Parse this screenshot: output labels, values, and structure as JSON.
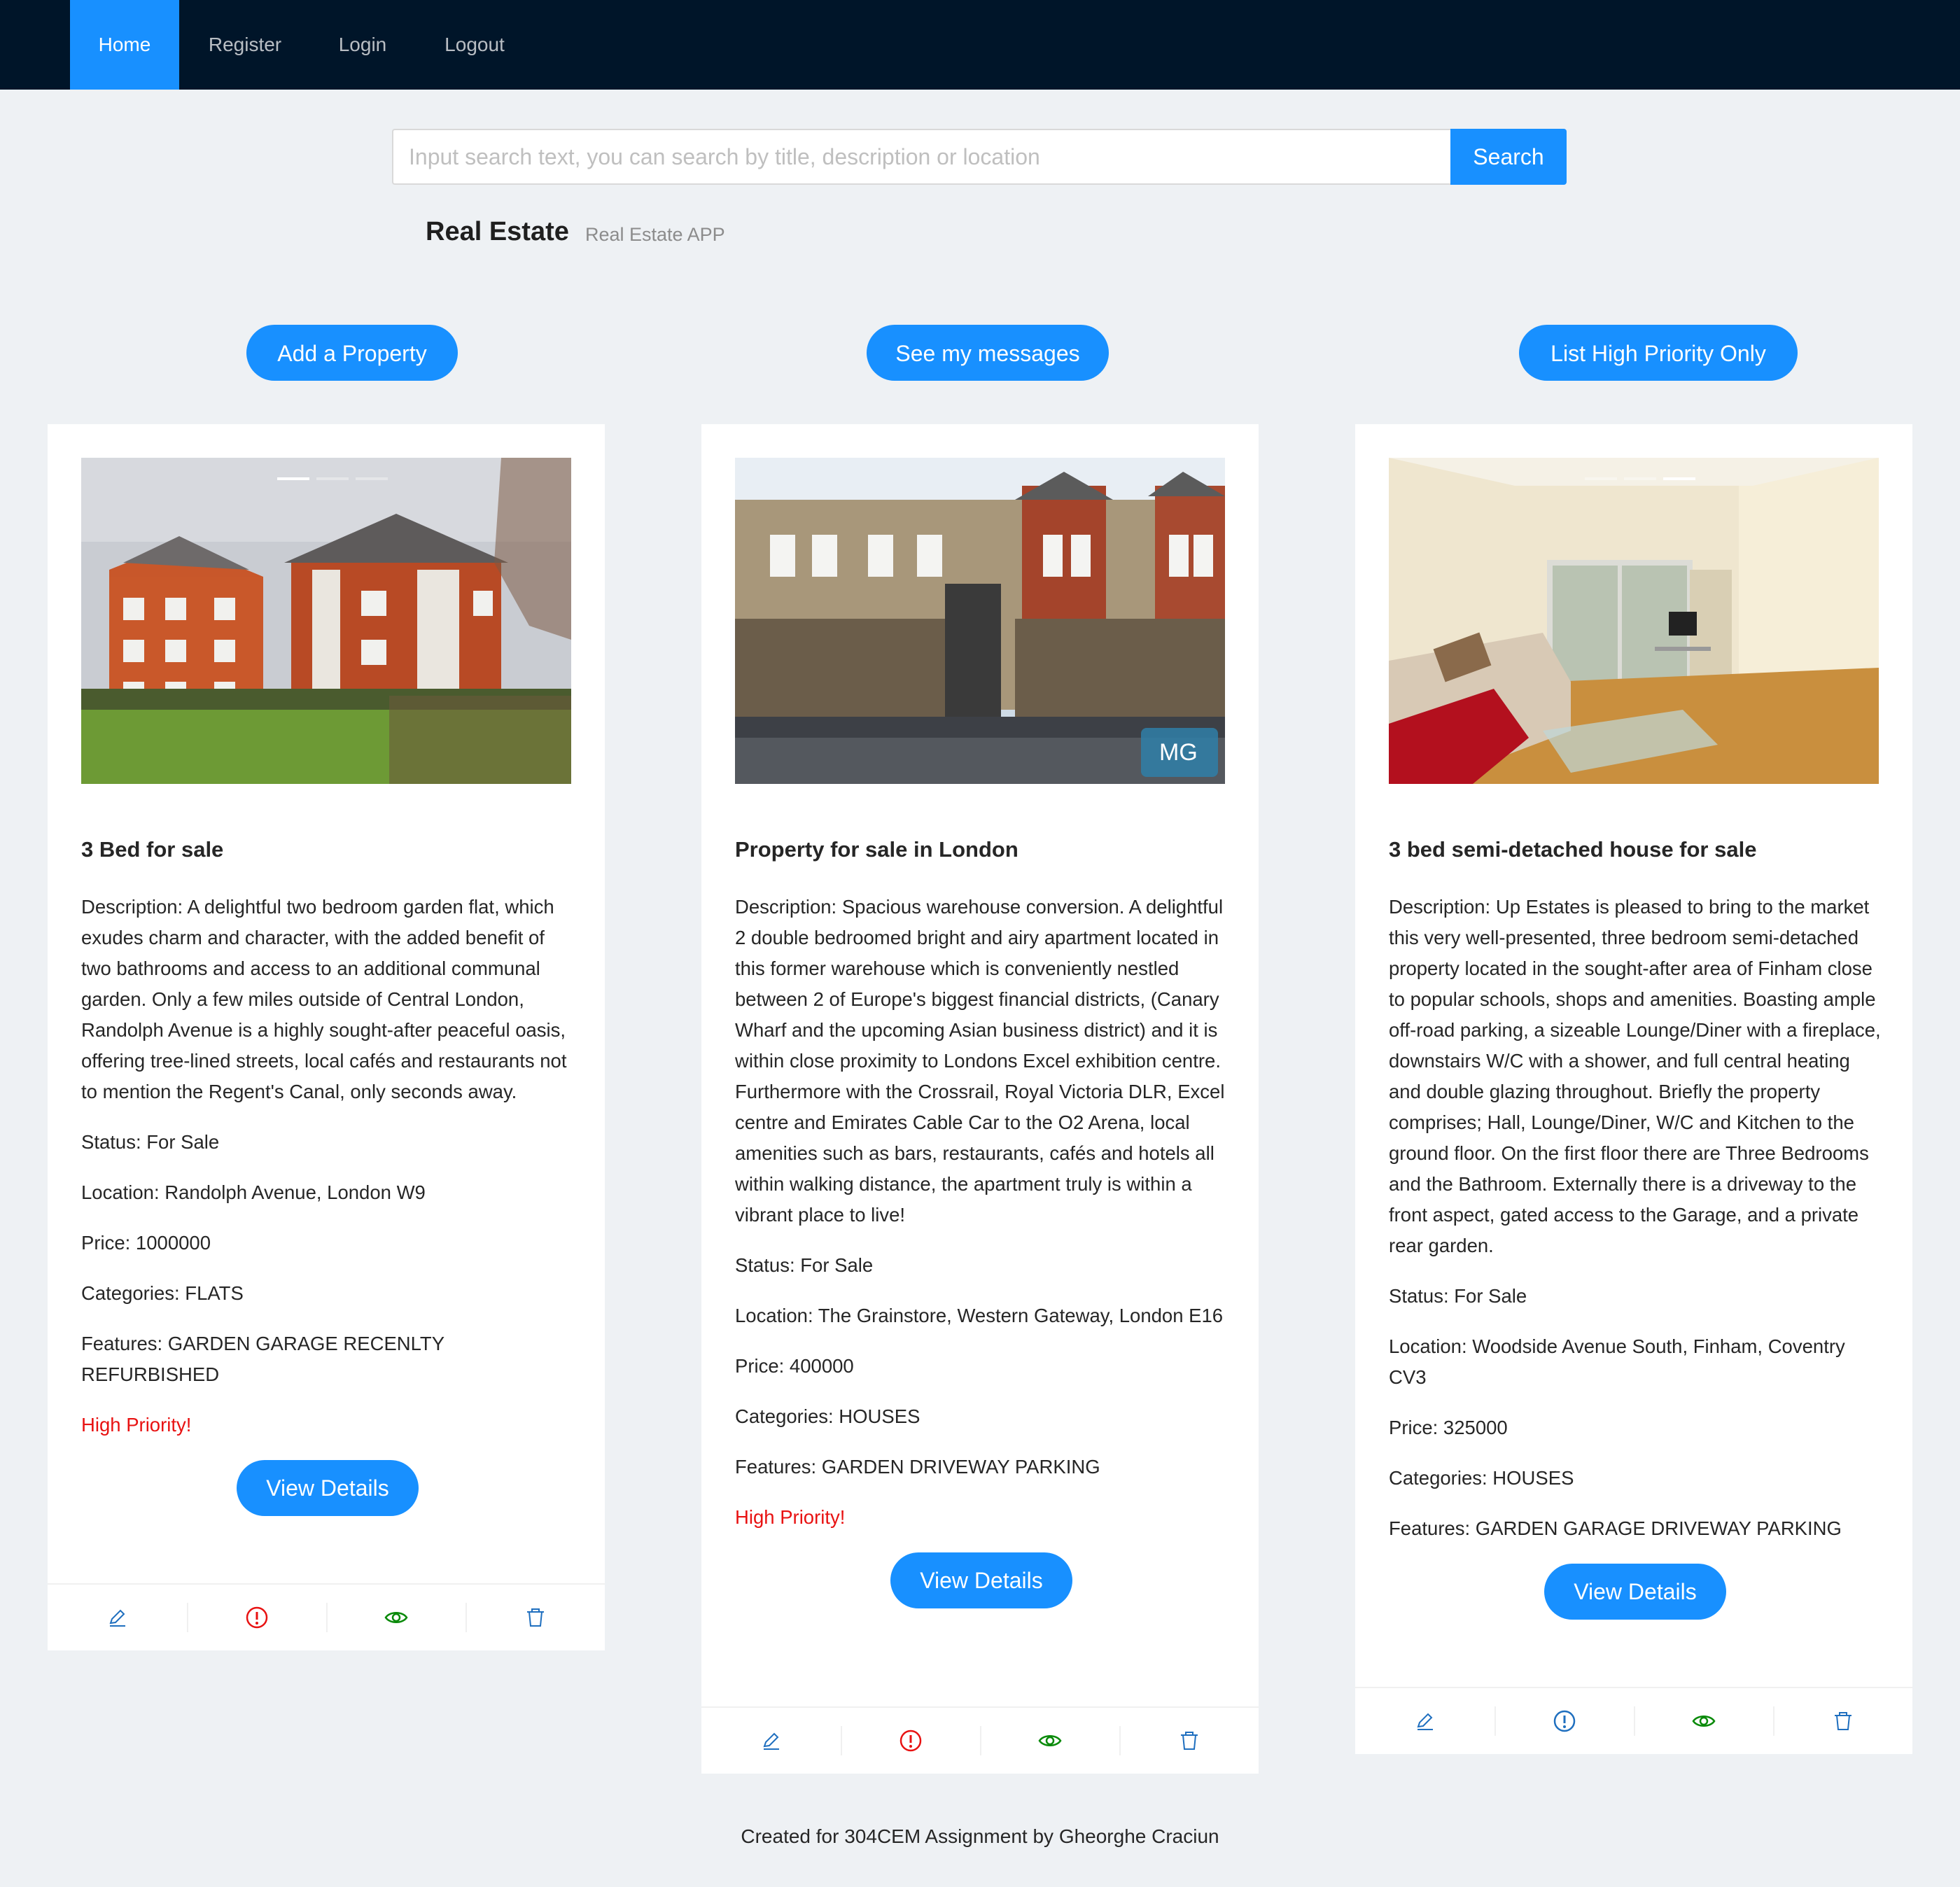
{
  "nav": {
    "items": [
      {
        "label": "Home",
        "active": true
      },
      {
        "label": "Register",
        "active": false
      },
      {
        "label": "Login",
        "active": false
      },
      {
        "label": "Logout",
        "active": false
      }
    ]
  },
  "search": {
    "placeholder": "Input search text, you can search by title, description or location",
    "value": "",
    "button_label": "Search"
  },
  "header": {
    "title": "Real Estate",
    "subtitle": "Real Estate APP"
  },
  "actions": {
    "add_property": "Add a Property",
    "see_messages": "See my messages",
    "list_high_priority": "List High Priority Only"
  },
  "properties": [
    {
      "title": "3 Bed for sale",
      "description": "Description: A delightful two bedroom garden flat, which exudes charm and character, with the added benefit of two bathrooms and access to an additional communal garden. Only a few miles outside of Central London, Randolph Avenue is a highly sought-after peaceful oasis, offering tree-lined streets, local cafés and restaurants not to mention the Regent's Canal, only seconds away.",
      "status": "Status: For Sale",
      "location": "Location: Randolph Avenue, London W9",
      "price": "Price: 1000000",
      "categories": "Categories: FLATS",
      "features": "Features: GARDEN GARAGE RECENLTY REFURBISHED",
      "priority": "High Priority!",
      "view_label": "View Details",
      "high_priority": true,
      "carousel_active": 1,
      "carousel_count": 3
    },
    {
      "title": "Property for sale in London",
      "description": "Description: Spacious warehouse conversion. A delightful 2 double bedroomed bright and airy apartment located in this former warehouse which is conveniently nestled between 2 of Europe's biggest financial districts, (Canary Wharf and the upcoming Asian business district) and it is within close proximity to Londons Excel exhibition centre. Furthermore with the Crossrail, Royal Victoria DLR, Excel centre and Emirates Cable Car to the O2 Arena, local amenities such as bars, restaurants, cafés and hotels all within walking distance, the apartment truly is within a vibrant place to live!",
      "status": "Status: For Sale",
      "location": "Location: The Grainstore, Western Gateway, London E16",
      "price": "Price: 400000",
      "categories": "Categories: HOUSES",
      "features": "Features: GARDEN DRIVEWAY PARKING",
      "priority": "High Priority!",
      "view_label": "View Details",
      "high_priority": true,
      "watermark": "MG",
      "carousel_active": 1,
      "carousel_count": 1
    },
    {
      "title": "3 bed semi-detached house for sale",
      "description": "Description: Up Estates is pleased to bring to the market this very well-presented, three bedroom semi-detached property located in the sought-after area of Finham close to popular schools, shops and amenities. Boasting ample off-road parking, a sizeable Lounge/Diner with a fireplace, downstairs W/C with a shower, and full central heating and double glazing throughout. Briefly the property comprises; Hall, Lounge/Diner, W/C and Kitchen to the ground floor. On the first floor there are Three Bedrooms and the Bathroom. Externally there is a driveway to the front aspect, gated access to the Garage, and a private rear garden.",
      "status": "Status: For Sale",
      "location": "Location: Woodside Avenue South, Finham, Coventry CV3",
      "price": "Price: 325000",
      "categories": "Categories: HOUSES",
      "features": "Features: GARDEN GARAGE DRIVEWAY PARKING",
      "priority": "",
      "view_label": "View Details",
      "high_priority": false,
      "carousel_active": 3,
      "carousel_count": 3
    }
  ],
  "card_action_icons": [
    "edit-icon",
    "exclamation-circle-icon",
    "eye-icon",
    "delete-icon"
  ],
  "colors": {
    "primary": "#1890ff",
    "nav_bg": "#001529",
    "priority_red": "#e81212",
    "view_green": "#0a8a0a"
  },
  "footer": {
    "text": "Created for 304CEM Assignment by Gheorghe Craciun"
  }
}
